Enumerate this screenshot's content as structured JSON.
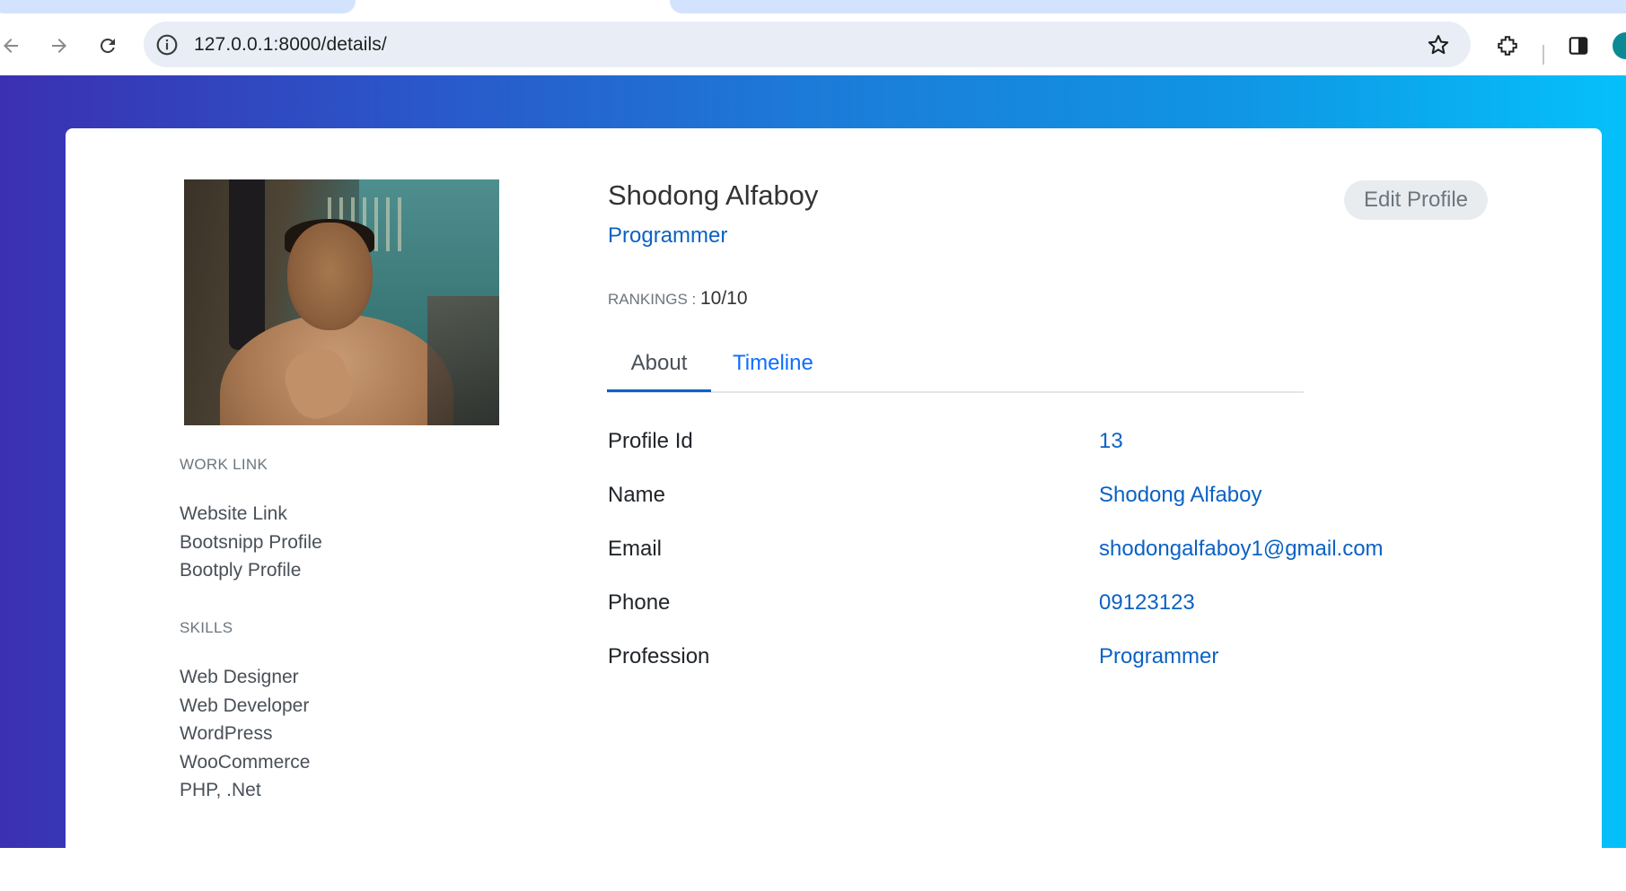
{
  "browser": {
    "url": "127.0.0.1:8000/details/"
  },
  "profile": {
    "name": "Shodong Alfaboy",
    "title": "Programmer",
    "rankings_label": "RANKINGS :",
    "rankings_value": "10/10",
    "edit_button": "Edit Profile"
  },
  "sidebar": {
    "work_title": "WORK LINK",
    "work_links": [
      "Website Link",
      "Bootsnipp Profile",
      "Bootply Profile"
    ],
    "skills_title": "SKILLS",
    "skills": [
      "Web Designer",
      "Web Developer",
      "WordPress",
      "WooCommerce",
      "PHP, .Net"
    ]
  },
  "tabs": [
    {
      "label": "About",
      "active": true
    },
    {
      "label": "Timeline",
      "active": false
    }
  ],
  "about": [
    {
      "label": "Profile Id",
      "value": "13"
    },
    {
      "label": "Name",
      "value": "Shodong Alfaboy"
    },
    {
      "label": "Email",
      "value": "shodongalfaboy1@gmail.com"
    },
    {
      "label": "Phone",
      "value": "09123123"
    },
    {
      "label": "Profession",
      "value": "Programmer"
    }
  ],
  "colors": {
    "accent": "#0b62c4",
    "gradient_start": "#3b30b1",
    "gradient_end": "#05c0fb"
  }
}
